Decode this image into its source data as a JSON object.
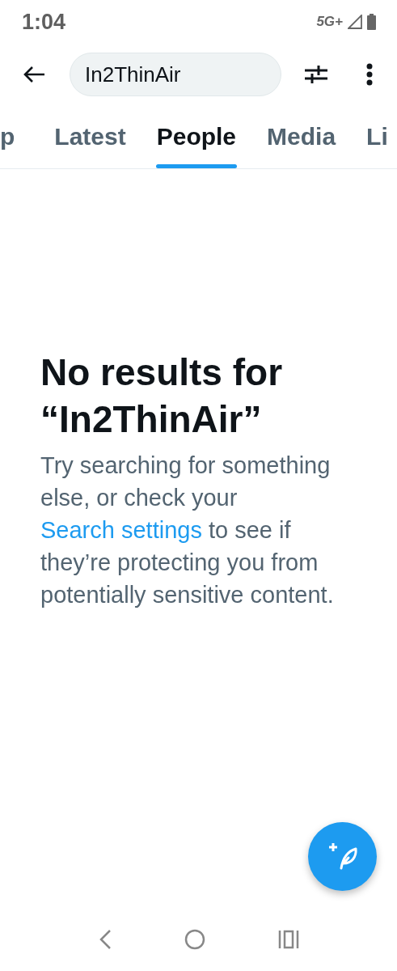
{
  "status_bar": {
    "time": "1:04",
    "network": "5G+"
  },
  "search": {
    "value": "In2ThinAir"
  },
  "tabs": [
    {
      "label": "p",
      "selected": false
    },
    {
      "label": "Latest",
      "selected": false
    },
    {
      "label": "People",
      "selected": true
    },
    {
      "label": "Media",
      "selected": false
    },
    {
      "label": "Li",
      "selected": false
    }
  ],
  "empty_state": {
    "title": "No results for “In2ThinAir”",
    "text_before": "Try searching for something else, or check your ",
    "link": "Search settings",
    "text_after": " to see if they’re protecting you from potentially sensitive content."
  }
}
